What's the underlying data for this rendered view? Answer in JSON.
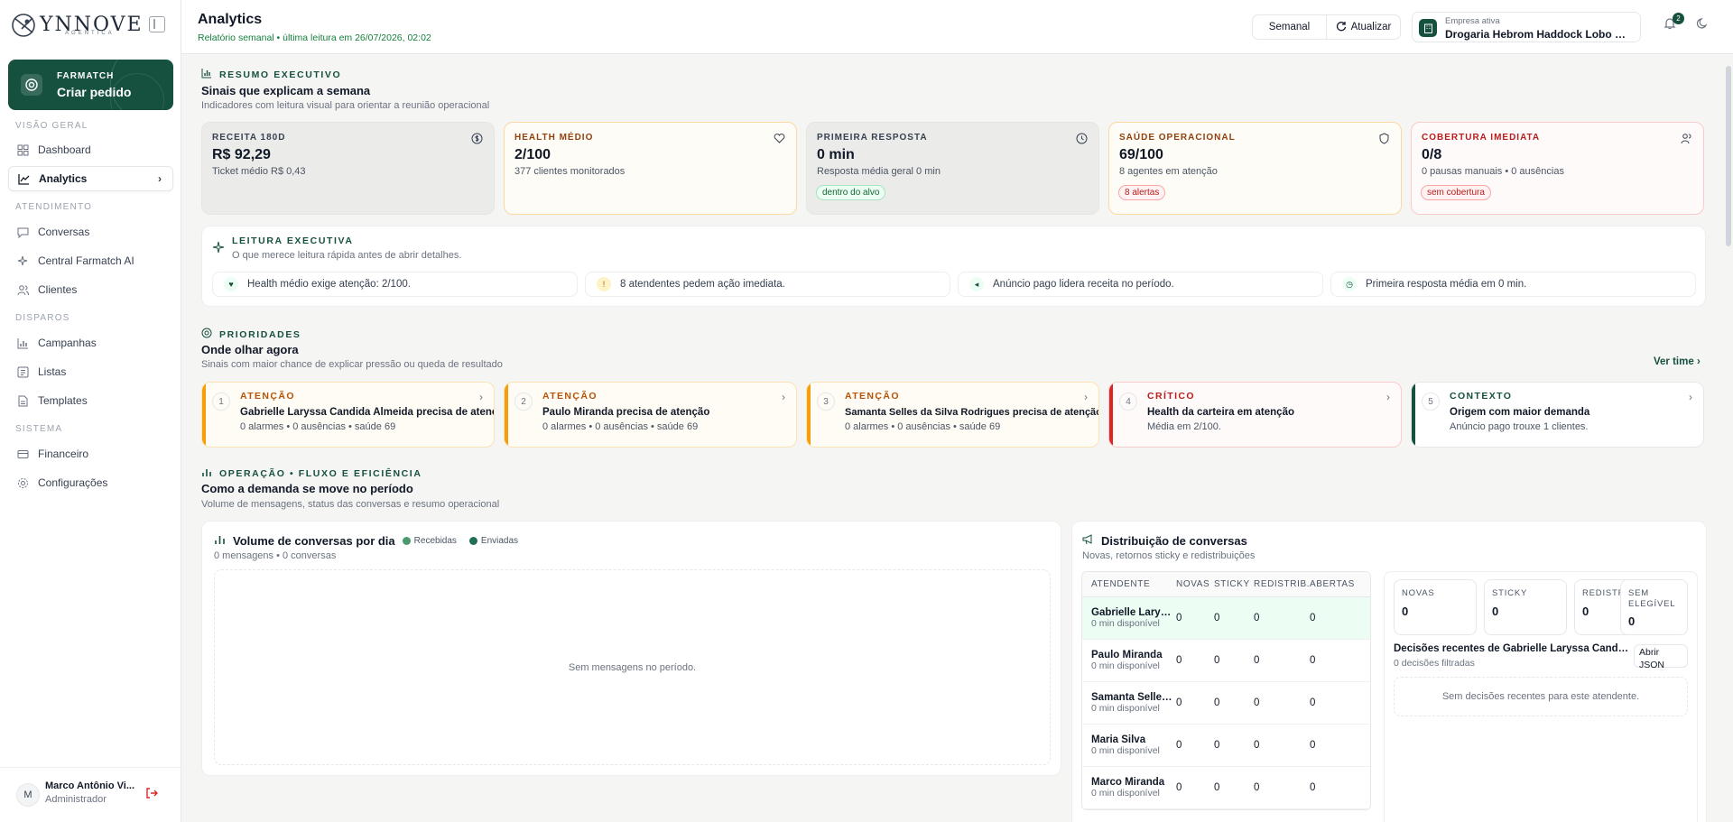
{
  "app": {
    "logo_text": "YNNOVE",
    "logo_sub": "AGENTICA"
  },
  "cta": {
    "kicker": "FARMATCH",
    "label": "Criar pedido"
  },
  "nav": {
    "sections": [
      "VISÃO GERAL",
      "ATENDIMENTO",
      "DISPAROS",
      "SISTEMA"
    ],
    "items": [
      {
        "label": "Dashboard",
        "icon": "grid-icon"
      },
      {
        "label": "Analytics",
        "icon": "chart-line-icon"
      },
      {
        "label": "Conversas",
        "icon": "chat-icon"
      },
      {
        "label": "Central Farmatch AI",
        "icon": "sparkles-icon"
      },
      {
        "label": "Clientes",
        "icon": "users-icon"
      },
      {
        "label": "Campanhas",
        "icon": "bar-chart-icon"
      },
      {
        "label": "Listas",
        "icon": "list-icon"
      },
      {
        "label": "Templates",
        "icon": "document-icon"
      },
      {
        "label": "Financeiro",
        "icon": "card-icon"
      },
      {
        "label": "Configurações",
        "icon": "gear-icon"
      }
    ]
  },
  "user": {
    "initial": "M",
    "name": "Marco Antônio Vi...",
    "role": "Administrador"
  },
  "header": {
    "title": "Analytics",
    "subtitle": "Relatório semanal • última leitura em 26/07/2026, 02:02",
    "period": "Semanal",
    "refresh": "Atualizar",
    "company_label": "Empresa ativa",
    "company_name": "Drogaria Hebrom Haddock Lobo LT...",
    "notifications": "2"
  },
  "resumo": {
    "kicker": "RESUMO EXECUTIVO",
    "title": "Sinais que explicam a semana",
    "subtitle": "Indicadores com leitura visual para orientar a reunião operacional",
    "kpis": [
      {
        "label": "RECEITA 180D",
        "value": "R$ 92,29",
        "sub": "Ticket médio R$ 0,43",
        "badge": "",
        "icon": "dollar-icon",
        "accent": "#374151"
      },
      {
        "label": "HEALTH MÉDIO",
        "value": "2/100",
        "sub": "377 clientes monitorados",
        "badge": "",
        "icon": "heart-icon",
        "accent": "#92400e"
      },
      {
        "label": "PRIMEIRA RESPOSTA",
        "value": "0 min",
        "sub": "Resposta média geral 0 min",
        "badge": "dentro do alvo",
        "icon": "clock-icon",
        "accent": "#374151"
      },
      {
        "label": "SAÚDE OPERACIONAL",
        "value": "69/100",
        "sub": "8 agentes em atenção",
        "badge": "8 alertas",
        "icon": "shield-icon",
        "accent": "#92400e"
      },
      {
        "label": "COBERTURA IMEDIATA",
        "value": "0/8",
        "sub": "0 pausas manuais • 0 ausências",
        "badge": "sem cobertura",
        "icon": "users-icon",
        "accent": "#b91c1c"
      }
    ]
  },
  "leitura": {
    "kicker": "LEITURA EXECUTIVA",
    "subtitle": "O que merece leitura rápida antes de abrir detalhes.",
    "chips": [
      "Health médio exige atenção: 2/100.",
      "8 atendentes pedem ação imediata.",
      "Anúncio pago lidera receita no período.",
      "Primeira resposta média em 0 min."
    ]
  },
  "prioridades": {
    "kicker": "PRIORIDADES",
    "title": "Onde olhar agora",
    "subtitle": "Sinais com maior chance de explicar pressão ou queda de resultado",
    "link": "Ver time",
    "items": [
      {
        "n": "1",
        "level": "ATENÇÃO",
        "title": "Gabrielle Laryssa Candida Almeida precisa de atenção",
        "sub": "0 alarmes • 0 ausências • saúde 69"
      },
      {
        "n": "2",
        "level": "ATENÇÃO",
        "title": "Paulo Miranda precisa de atenção",
        "sub": "0 alarmes • 0 ausências • saúde 69"
      },
      {
        "n": "3",
        "level": "ATENÇÃO",
        "title": "Samanta Selles da Silva Rodrigues precisa de atenção",
        "sub": "0 alarmes • 0 ausências • saúde 69"
      },
      {
        "n": "4",
        "level": "CRÍTICO",
        "title": "Health da carteira em atenção",
        "sub": "Média em 2/100."
      },
      {
        "n": "5",
        "level": "CONTEXTO",
        "title": "Origem com maior demanda",
        "sub": "Anúncio pago trouxe 1 clientes."
      }
    ]
  },
  "operacao": {
    "kicker": "OPERAÇÃO • FLUXO E EFICIÊNCIA",
    "title": "Como a demanda se move no período",
    "subtitle": "Volume de mensagens, status das conversas e resumo operacional"
  },
  "volume": {
    "title": "Volume de conversas por dia",
    "legend_received": "Recebidas",
    "legend_sent": "Enviadas",
    "summary": "0 mensagens • 0 conversas",
    "empty": "Sem mensagens no período."
  },
  "distrib": {
    "title": "Distribuição de conversas",
    "subtitle": "Novas, retornos sticky e redistribuições",
    "headers": [
      "ATENDENTE",
      "NOVAS",
      "STICKY",
      "REDISTRIB.",
      "ABERTAS"
    ],
    "rows": [
      {
        "name": "Gabrielle Laryssa...",
        "sub": "0 min disponível",
        "v": [
          "0",
          "0",
          "0",
          "0"
        ]
      },
      {
        "name": "Paulo Miranda",
        "sub": "0 min disponível",
        "v": [
          "0",
          "0",
          "0",
          "0"
        ]
      },
      {
        "name": "Samanta Selles d...",
        "sub": "0 min disponível",
        "v": [
          "0",
          "0",
          "0",
          "0"
        ]
      },
      {
        "name": "Maria Silva",
        "sub": "0 min disponível",
        "v": [
          "0",
          "0",
          "0",
          "0"
        ]
      },
      {
        "name": "Marco Miranda",
        "sub": "0 min disponível",
        "v": [
          "0",
          "0",
          "0",
          "0"
        ]
      }
    ],
    "minis": [
      {
        "label": "NOVAS",
        "value": "0"
      },
      {
        "label": "STICKY",
        "value": "0"
      },
      {
        "label": "REDISTRIB.",
        "value": "0"
      },
      {
        "label": "SEM ELEGÍVEL",
        "value": "0"
      }
    ],
    "decisions_title": "Decisões recentes de Gabrielle Laryssa Candida A...",
    "decisions_sub": "0 decisões filtradas",
    "open_json": "Abrir JSON",
    "empty": "Sem decisões recentes para este atendente."
  },
  "colors": {
    "brand": "#16503f",
    "received": "#4a9a6e",
    "sent": "#1f6e55",
    "warn": "#f59e0b",
    "critical": "#dc2626",
    "context": "#16503f"
  }
}
